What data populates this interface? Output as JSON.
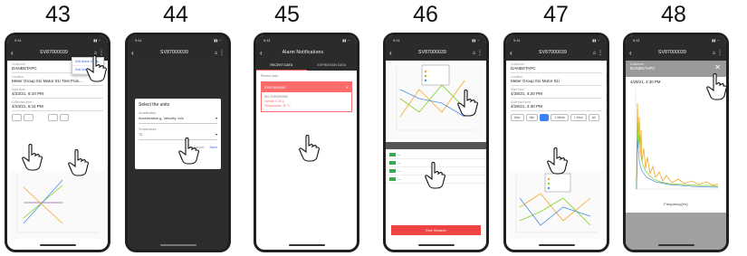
{
  "steps": [
    {
      "number": "43",
      "header_title": "SV87000039",
      "menu": [
        "Edit Alarm Setup",
        "Edit Units"
      ],
      "fields": [
        {
          "label": "Customer",
          "value": "DANBSTAPC"
        },
        {
          "label": "Location",
          "value": "Meter Group 01/ Motor 01/ Test Poin..."
        },
        {
          "label": "Start time",
          "value": "4/23/21, 6:10 PM"
        },
        {
          "label": "Collected time",
          "value": "4/23/21, 6:11 PM"
        }
      ]
    },
    {
      "number": "44",
      "header_title": "SV87000039",
      "dialog_title": "Select the units",
      "dialog_fields": [
        {
          "label": "Acceleration",
          "value": "Acceleration g, Velocity: in/s"
        },
        {
          "label": "Temperature",
          "value": "°C"
        }
      ],
      "dialog_actions": [
        "Cancel",
        "Save"
      ]
    },
    {
      "number": "45",
      "header_title": "Alarm Notifications",
      "tabs": [
        "RECENT DATA",
        "EXPIRATION DATA"
      ],
      "section_label": "Recent data",
      "alarm_title": "SV87000040",
      "alarm_lines": [
        "SN: SV87000039",
        "Overall: 0.25 g",
        "Temperature: 30 °C"
      ]
    },
    {
      "number": "46",
      "header_title": "SV87000039",
      "action_label": "End Session"
    },
    {
      "number": "47",
      "header_title": "SV87000039",
      "fields": [
        {
          "label": "Customer",
          "value": "DANBSTAPC"
        },
        {
          "label": "Location",
          "value": "Meter Group 01/ Motor 01/"
        },
        {
          "label": "Start time",
          "value": "4/28/21, 4:20 PM"
        },
        {
          "label": "Collected time",
          "value": "4/28/21, 4:30 PM"
        }
      ],
      "buttons": [
        "Max",
        "Min",
        "",
        "1 Week",
        "1 Mon",
        "All"
      ]
    },
    {
      "number": "48",
      "header_title": "SV87000039",
      "customer_label": "Customer",
      "customer_value": "DANBSTAPC",
      "timestamp": "4/28/21, 4:30 PM",
      "xlabel": "Frequency(Hz)"
    }
  ],
  "colors": {
    "header_dark": "#2b2b2b",
    "accent_red": "#ff6b6b",
    "accent_blue": "#3b82f6",
    "series_orange": "#f5a623",
    "series_green": "#7ed321",
    "series_blue": "#4a90e2",
    "series_purple": "#9b59b6"
  }
}
